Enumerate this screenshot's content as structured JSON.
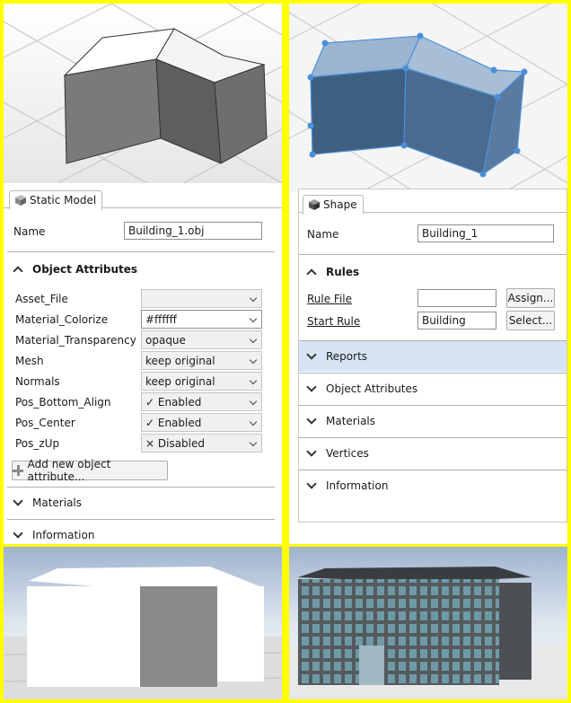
{
  "left_panel": {
    "tab_label": "Static Model",
    "name_label": "Name",
    "name_value": "Building_1.obj",
    "attributes_section": "Object Attributes",
    "attributes": [
      {
        "name": "Asset_File",
        "value": ""
      },
      {
        "name": "Material_Colorize",
        "value": "#ffffff"
      },
      {
        "name": "Material_Transparency",
        "value": "opaque"
      },
      {
        "name": "Mesh",
        "value": "keep original"
      },
      {
        "name": "Normals",
        "value": "keep original"
      },
      {
        "name": "Pos_Bottom_Align",
        "value": "✓ Enabled"
      },
      {
        "name": "Pos_Center",
        "value": "✓ Enabled"
      },
      {
        "name": "Pos_zUp",
        "value": "× Disabled"
      }
    ],
    "add_attribute_label": "Add new object attribute...",
    "sections": [
      "Materials",
      "Information"
    ]
  },
  "right_panel": {
    "tab_label": "Shape",
    "name_label": "Name",
    "name_value": "Building_1",
    "rules_section": "Rules",
    "rule_file_label": "Rule File",
    "rule_file_value": "",
    "assign_label": "Assign...",
    "start_rule_label": "Start Rule",
    "start_rule_value": "Building",
    "select_label": "Select...",
    "sections": [
      "Reports",
      "Object Attributes",
      "Materials",
      "Vertices",
      "Information"
    ]
  },
  "colors": {
    "frame": "#ffff00",
    "selection_blue": "#4a90d9",
    "reports_highlight": "#d6e4f3"
  }
}
